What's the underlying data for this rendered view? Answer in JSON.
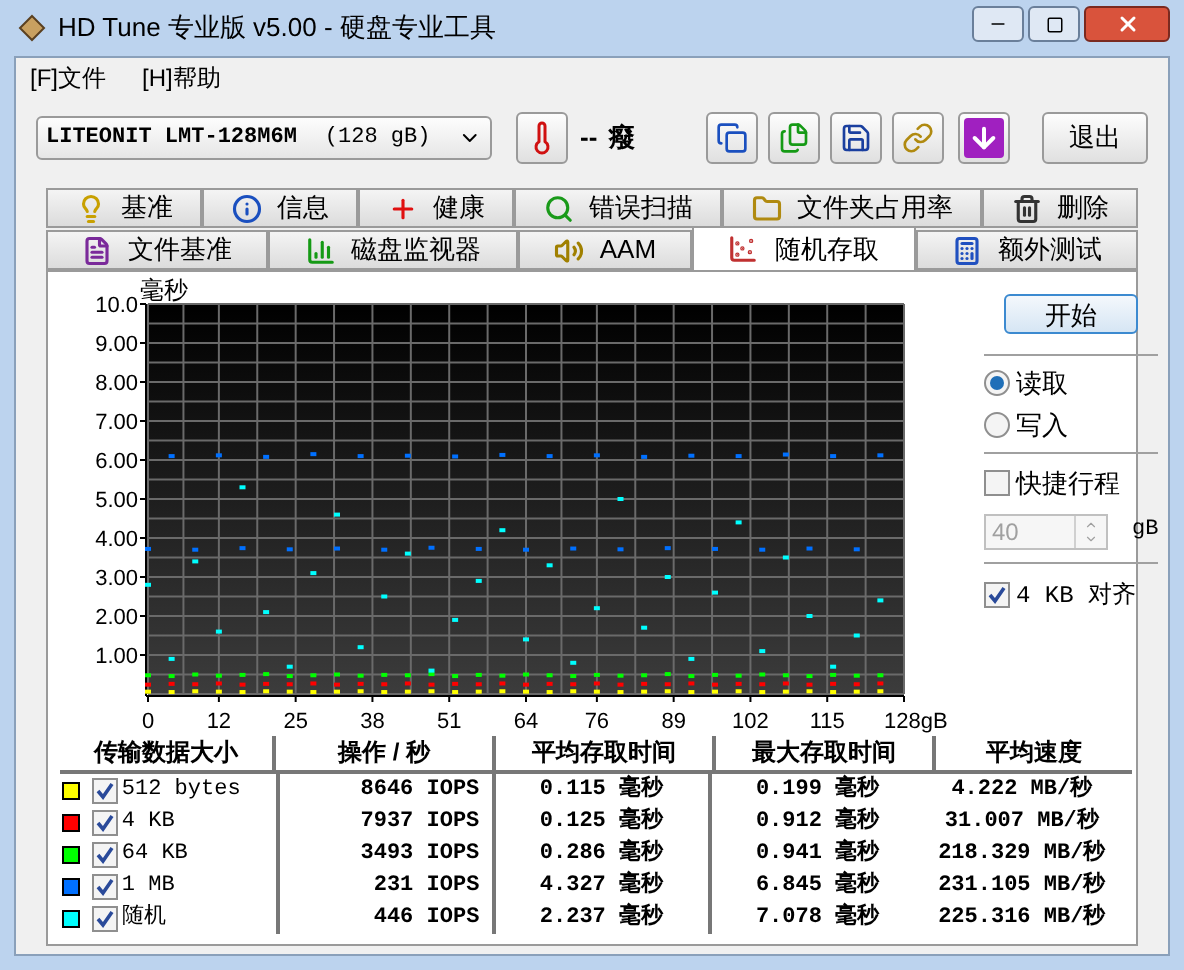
{
  "window": {
    "title": "HD Tune 专业版 v5.00 - 硬盘专业工具"
  },
  "menu": [
    "[F]文件",
    "[H]帮助"
  ],
  "toolbar": {
    "drive": {
      "name": "LITEONIT LMT-128M6M",
      "capacity": "(128 gB)"
    },
    "temperature": "--",
    "temperature_unit": "癈",
    "exit_button": "退出"
  },
  "tab_rows": [
    [
      {
        "label": "基准",
        "selected": false
      },
      {
        "label": "信息",
        "selected": false
      },
      {
        "label": "健康",
        "selected": false
      },
      {
        "label": "错误扫描",
        "selected": false
      },
      {
        "label": "文件夹占用率",
        "selected": false
      },
      {
        "label": "删除",
        "selected": false
      }
    ],
    [
      {
        "label": "文件基准",
        "selected": false
      },
      {
        "label": "磁盘监视器",
        "selected": false
      },
      {
        "label": "AAM",
        "selected": false
      },
      {
        "label": "随机存取",
        "selected": true
      },
      {
        "label": "额外测试",
        "selected": false
      }
    ]
  ],
  "chart": {
    "chart_data": {
      "type": "scatter",
      "ylabel": "毫秒",
      "x": [
        0,
        4,
        8,
        12,
        16,
        20,
        24,
        28,
        32,
        36,
        40,
        44,
        48,
        52,
        56,
        60,
        64,
        68,
        72,
        76,
        80,
        84,
        88,
        92,
        96,
        100,
        104,
        108,
        112,
        116,
        120,
        124
      ],
      "series": [
        {
          "color": "#ffff00",
          "values": [
            0.06,
            0.05,
            0.07,
            0.06,
            0.05,
            0.07,
            0.06,
            0.05,
            0.06,
            0.07,
            0.05,
            0.06,
            0.07,
            0.05,
            0.06,
            0.07,
            0.06,
            0.05,
            0.07,
            0.06,
            0.05,
            0.06,
            0.07,
            0.05,
            0.06,
            0.07,
            0.05,
            0.06,
            0.07,
            0.05,
            0.06,
            0.07
          ]
        },
        {
          "color": "#ff0000",
          "values": [
            0.24,
            0.26,
            0.25,
            0.27,
            0.24,
            0.26,
            0.25,
            0.27,
            0.24,
            0.26,
            0.25,
            0.27,
            0.24,
            0.26,
            0.25,
            0.27,
            0.24,
            0.26,
            0.25,
            0.27,
            0.24,
            0.26,
            0.25,
            0.27,
            0.24,
            0.26,
            0.25,
            0.27,
            0.24,
            0.26,
            0.25,
            0.27
          ]
        },
        {
          "color": "#00ff00",
          "values": [
            0.48,
            0.46,
            0.5,
            0.47,
            0.49,
            0.51,
            0.46,
            0.48,
            0.5,
            0.47,
            0.49,
            0.48,
            0.51,
            0.46,
            0.49,
            0.47,
            0.5,
            0.48,
            0.46,
            0.49,
            0.47,
            0.48,
            0.51,
            0.46,
            0.49,
            0.47,
            0.5,
            0.48,
            0.46,
            0.49,
            0.47,
            0.48
          ]
        },
        {
          "color": "#0070ff",
          "values": [
            3.72,
            6.1,
            3.7,
            6.12,
            3.74,
            6.08,
            3.71,
            6.15,
            3.73,
            6.1,
            3.7,
            6.11,
            3.75,
            6.09,
            3.72,
            6.13,
            3.7,
            6.1,
            3.73,
            6.12,
            3.71,
            6.08,
            3.74,
            6.11,
            3.72,
            6.1,
            3.7,
            6.14,
            3.73,
            6.1,
            3.71,
            6.12
          ]
        },
        {
          "color": "#00ffff",
          "values": [
            2.8,
            0.9,
            3.4,
            1.6,
            5.3,
            2.1,
            0.7,
            3.1,
            4.6,
            1.2,
            2.5,
            3.6,
            0.6,
            1.9,
            2.9,
            4.2,
            1.4,
            3.3,
            0.8,
            2.2,
            5.0,
            1.7,
            3.0,
            0.9,
            2.6,
            4.4,
            1.1,
            3.5,
            2.0,
            0.7,
            1.5,
            2.4
          ]
        }
      ],
      "grid": true,
      "xlim": [
        0,
        128
      ],
      "ylim": [
        0,
        10
      ],
      "xticks": [
        0,
        12,
        25,
        38,
        51,
        64,
        76,
        89,
        102,
        115,
        {
          "value": 128,
          "label": "128gB"
        }
      ],
      "yticks": [
        {
          "value": 1,
          "label": "1.00"
        },
        {
          "value": 2,
          "label": "2.00"
        },
        {
          "value": 3,
          "label": "3.00"
        },
        {
          "value": 4,
          "label": "4.00"
        },
        {
          "value": 5,
          "label": "5.00"
        },
        {
          "value": 6,
          "label": "6.00"
        },
        {
          "value": 7,
          "label": "7.00"
        },
        {
          "value": 8,
          "label": "8.00"
        },
        {
          "value": 9,
          "label": "9.00"
        },
        {
          "value": 10,
          "label": "10.0"
        }
      ]
    }
  },
  "controls": {
    "start_button": "开始",
    "modes": [
      {
        "label": "读取",
        "selected": true
      },
      {
        "label": "写入",
        "selected": false
      }
    ],
    "short_stroke": {
      "label": "快捷行程",
      "checked": false
    },
    "stroke_size": {
      "value": "40",
      "unit": "gB",
      "disabled": true
    },
    "align_4kb": {
      "label": "4 KB 对齐",
      "checked": true
    }
  },
  "table": {
    "columns": [
      "传输数据大小",
      "操作 / 秒",
      "平均存取时间",
      "最大存取时间",
      "平均速度"
    ],
    "rows": [
      {
        "color": "#ffff00",
        "checked": true,
        "size": "512 bytes",
        "ops": "8646 IOPS",
        "avg": "0.115 毫秒",
        "max": "0.199 毫秒",
        "speed": "4.222 MB/秒"
      },
      {
        "color": "#ff0000",
        "checked": true,
        "size": "4 KB",
        "ops": "7937 IOPS",
        "avg": "0.125 毫秒",
        "max": "0.912 毫秒",
        "speed": "31.007 MB/秒"
      },
      {
        "color": "#00ff00",
        "checked": true,
        "size": "64 KB",
        "ops": "3493 IOPS",
        "avg": "0.286 毫秒",
        "max": "0.941 毫秒",
        "speed": "218.329 MB/秒"
      },
      {
        "color": "#0070ff",
        "checked": true,
        "size": "1 MB",
        "ops": "231 IOPS",
        "avg": "4.327 毫秒",
        "max": "6.845 毫秒",
        "speed": "231.105 MB/秒"
      },
      {
        "color": "#00ffff",
        "checked": true,
        "size": "随机",
        "ops": "446 IOPS",
        "avg": "2.237 毫秒",
        "max": "7.078 毫秒",
        "speed": "225.316 MB/秒"
      }
    ]
  }
}
